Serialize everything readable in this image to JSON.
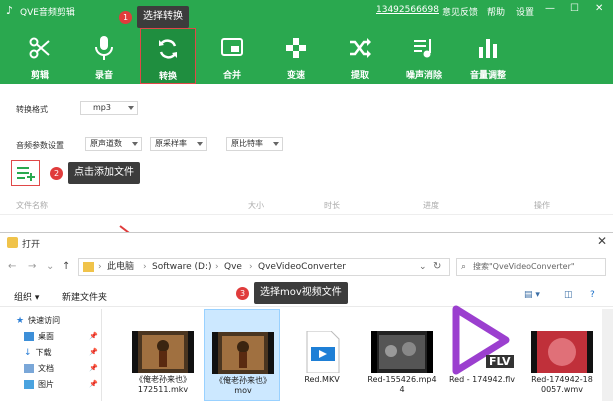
{
  "app": {
    "title": "QVE音频剪辑",
    "phone": "13492566698",
    "feedback": "意见反馈",
    "help": "帮助",
    "settings": "设置"
  },
  "toolbar": [
    {
      "label": "剪辑",
      "icon": "scissors-icon"
    },
    {
      "label": "录音",
      "icon": "microphone-icon"
    },
    {
      "label": "转换",
      "icon": "convert-icon",
      "active": true
    },
    {
      "label": "合并",
      "icon": "merge-icon"
    },
    {
      "label": "变速",
      "icon": "speed-icon"
    },
    {
      "label": "提取",
      "icon": "shuffle-icon"
    },
    {
      "label": "噪声消除",
      "icon": "playlist-icon"
    },
    {
      "label": "音量调整",
      "icon": "volume-bars-icon"
    }
  ],
  "settings": {
    "format_label": "转换格式",
    "format_value": "mp3",
    "params_label": "音频参数设置",
    "channels": "原声道数",
    "sample_rate": "原采样率",
    "bit_rate": "原比特率"
  },
  "steps": [
    {
      "num": "1",
      "text": "选择转换"
    },
    {
      "num": "2",
      "text": "点击添加文件"
    },
    {
      "num": "3",
      "text": "选择mov视频文件"
    }
  ],
  "columns": [
    "文件名称",
    "大小",
    "时长",
    "进度",
    "操作"
  ],
  "dialog": {
    "title": "打开",
    "crumbs": [
      "此电脑",
      "Software (D:)",
      "Qve",
      "QveVideoConverter"
    ],
    "search_placeholder": "搜索\"QveVideoConverter\"",
    "organize": "组织 ▾",
    "new_folder": "新建文件夹",
    "nav": [
      {
        "label": "快速访问"
      },
      {
        "label": "桌面"
      },
      {
        "label": "下载"
      },
      {
        "label": "文档"
      },
      {
        "label": "图片"
      }
    ],
    "files": [
      {
        "name": "《俺老孙来也》",
        "sub": "172511.mkv"
      },
      {
        "name": "《俺老孙来也》",
        "sub": "mov"
      },
      {
        "name": "Red.MKV",
        "sub": ""
      },
      {
        "name": "Red-155426.mp4",
        "sub": "4"
      },
      {
        "name": "Red - 174942.flv",
        "sub": ""
      },
      {
        "name": "Red-174942-18",
        "sub": "0057.wmv"
      }
    ],
    "flv_badge": "FLV"
  },
  "colors": {
    "brand_green": "#2aa84f",
    "active_green": "#1f8e3f",
    "step_red": "#e03c3c"
  }
}
